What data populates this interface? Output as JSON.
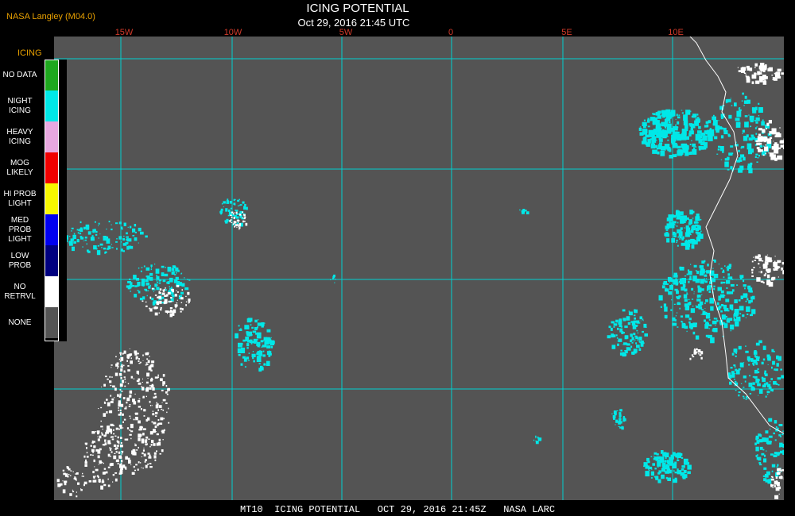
{
  "header": {
    "source": "NASA Langley (M04.0)",
    "title": "ICING POTENTIAL",
    "timestamp": "Oct 29, 2016 21:45 UTC"
  },
  "longitude_labels": [
    "15W",
    "10W",
    "5W",
    "0",
    "5E",
    "10E"
  ],
  "latitude_labels": [
    "",
    "",
    "",
    ""
  ],
  "legend": {
    "title": "ICING",
    "items": [
      {
        "label": "NO DATA",
        "color": "#1ea81e"
      },
      {
        "label": "NIGHT\nICING",
        "color": "#00e8e8"
      },
      {
        "label": "HEAVY\nICING",
        "color": "#e8a8e0"
      },
      {
        "label": "MOG\nLIKELY",
        "color": "#f00000"
      },
      {
        "label": "HI PROB\nLIGHT",
        "color": "#f8f800"
      },
      {
        "label": "MED PROB\nLIGHT",
        "color": "#0000f0"
      },
      {
        "label": "LOW\nPROB",
        "color": "#000080"
      },
      {
        "label": "NO\nRETRVL",
        "color": "#ffffff"
      },
      {
        "label": "NONE",
        "color": "#545454"
      }
    ]
  },
  "footer": "MT10  ICING POTENTIAL   OCT 29, 2016 21:45Z   NASA LARC",
  "colors": {
    "background": "#545454",
    "grid": "#00d0d0",
    "icing": "#00e8e8",
    "no_retrieval": "#ffffff",
    "coastline": "#ffffff"
  }
}
